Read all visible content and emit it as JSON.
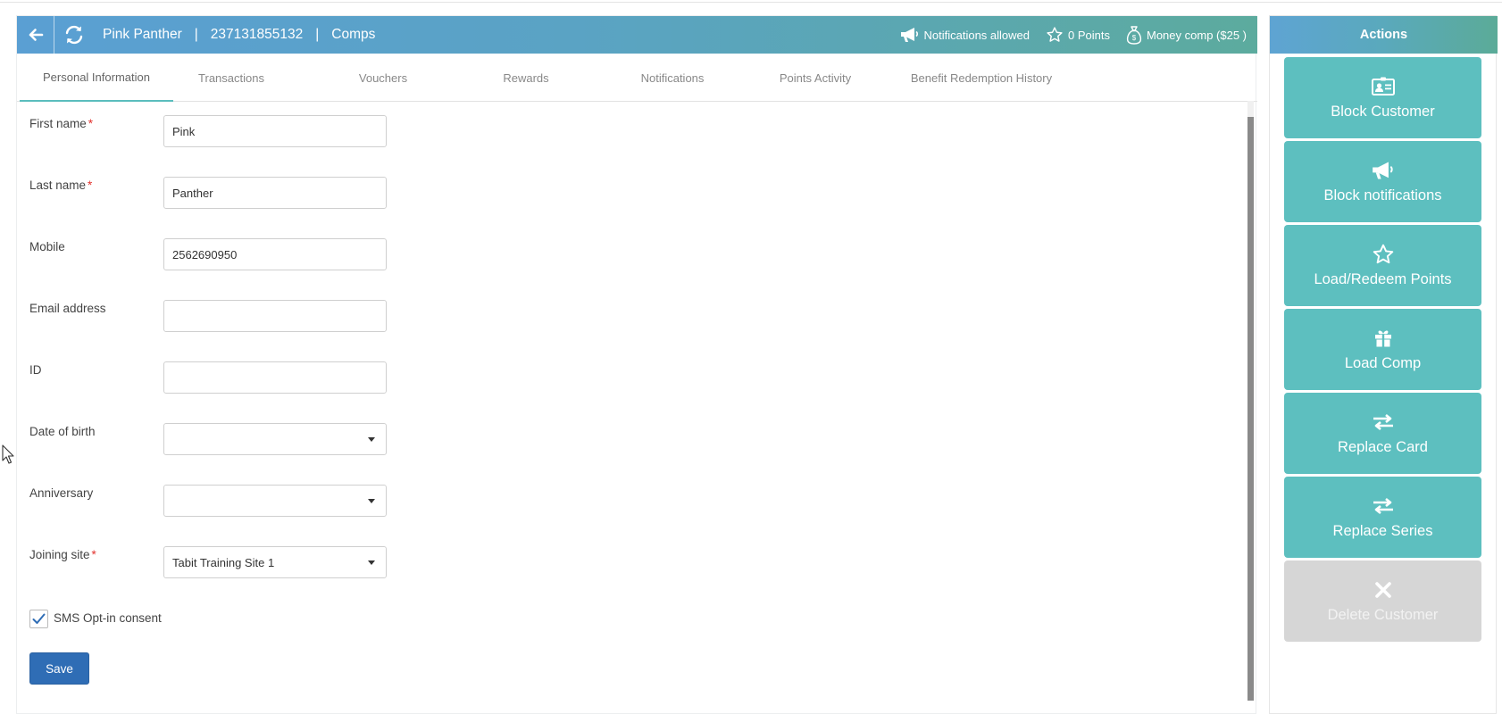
{
  "header": {
    "customer_name": "Pink Panther",
    "separator": "|",
    "customer_id": "237131855132",
    "section": "Comps",
    "notifications_status": "Notifications allowed",
    "points": "0 Points",
    "money_comp": "Money comp ($25 )",
    "icons": {
      "back": "arrow-left-icon",
      "refresh": "refresh-icon",
      "notifications": "megaphone-icon",
      "points": "star-icon",
      "money": "money-bag-icon"
    }
  },
  "tabs": [
    {
      "label": "Personal Information",
      "active": true
    },
    {
      "label": "Transactions",
      "active": false
    },
    {
      "label": "Vouchers",
      "active": false
    },
    {
      "label": "Rewards",
      "active": false
    },
    {
      "label": "Notifications",
      "active": false
    },
    {
      "label": "Points Activity",
      "active": false
    },
    {
      "label": "Benefit Redemption History",
      "active": false
    }
  ],
  "form": {
    "required_mark": "*",
    "first_name": {
      "label": "First name",
      "value": "Pink"
    },
    "last_name": {
      "label": "Last name",
      "value": "Panther"
    },
    "mobile": {
      "label": "Mobile",
      "value": "2562690950"
    },
    "email": {
      "label": "Email address",
      "value": ""
    },
    "id": {
      "label": "ID",
      "value": ""
    },
    "date_of_birth": {
      "label": "Date of birth",
      "value": ""
    },
    "anniversary": {
      "label": "Anniversary",
      "value": ""
    },
    "joining_site": {
      "label": "Joining site",
      "value": "Tabit Training Site 1"
    },
    "sms_consent": {
      "label": "SMS Opt-in consent",
      "checked": true
    },
    "save_label": "Save"
  },
  "actions": {
    "title": "Actions",
    "items": [
      {
        "label": "Block Customer",
        "icon": "id-card-icon",
        "enabled": true
      },
      {
        "label": "Block notifications",
        "icon": "megaphone-icon",
        "enabled": true
      },
      {
        "label": "Load/Redeem Points",
        "icon": "star-icon",
        "enabled": true
      },
      {
        "label": "Load Comp",
        "icon": "gift-icon",
        "enabled": true
      },
      {
        "label": "Replace Card",
        "icon": "exchange-icon",
        "enabled": true
      },
      {
        "label": "Replace Series",
        "icon": "exchange-icon",
        "enabled": true
      },
      {
        "label": "Delete Customer",
        "icon": "close-icon",
        "enabled": false
      }
    ]
  },
  "colors": {
    "header_gradient_start": "#5a9fd3",
    "header_gradient_end": "#5cab9e",
    "action_button": "#5dbfbf",
    "action_button_disabled": "#d6d6d6",
    "save_button": "#2f6db5",
    "tab_active_underline": "#5bbdbd",
    "required_mark": "#e2322d"
  }
}
